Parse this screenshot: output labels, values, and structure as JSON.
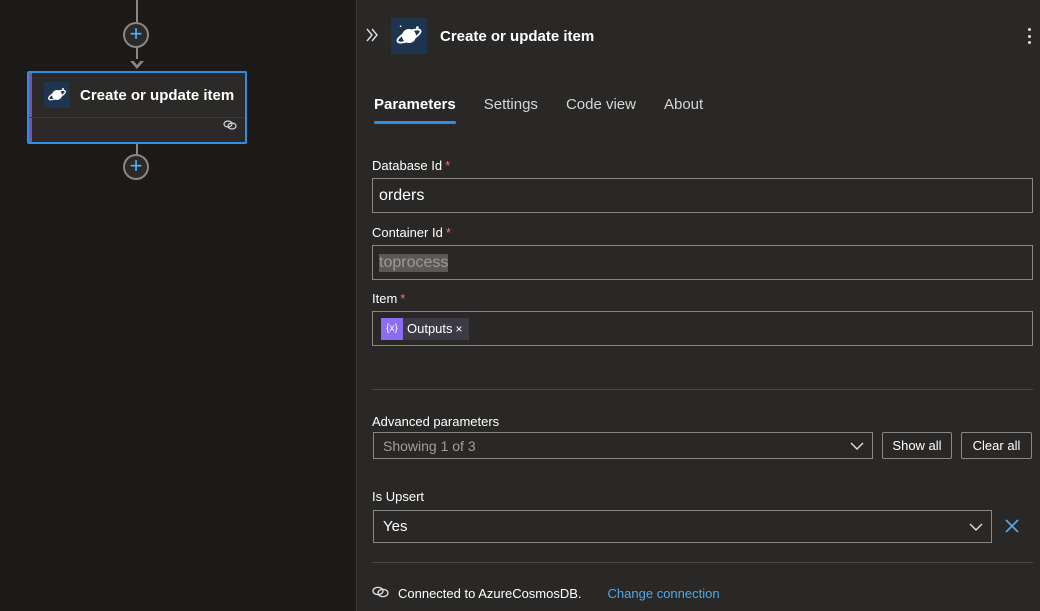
{
  "canvas": {
    "node": {
      "title": "Create or update item",
      "icon": "cosmos-db-icon"
    },
    "add_symbol": "+"
  },
  "panel": {
    "title": "Create or update item",
    "tabs": [
      {
        "label": "Parameters",
        "active": true
      },
      {
        "label": "Settings",
        "active": false
      },
      {
        "label": "Code view",
        "active": false
      },
      {
        "label": "About",
        "active": false
      }
    ],
    "fields": {
      "database_id": {
        "label": "Database Id",
        "required": "*",
        "value": "orders"
      },
      "container_id": {
        "label": "Container Id",
        "required": "*",
        "value": "toprocess"
      },
      "item": {
        "label": "Item",
        "required": "*",
        "token": {
          "icon_text": "{x}",
          "label": "Outputs",
          "remove": "×"
        }
      }
    },
    "advanced": {
      "label": "Advanced parameters",
      "value": "Showing 1 of 3",
      "show_all": "Show all",
      "clear_all": "Clear all"
    },
    "is_upsert": {
      "label": "Is Upsert",
      "value": "Yes"
    },
    "footer": {
      "connection_text": "Connected to AzureCosmosDB.",
      "change_link": "Change connection"
    }
  },
  "colors": {
    "accent_blue": "#2f8ee0",
    "link_blue": "#4fa8e8",
    "required_red": "#f1707b",
    "token_purple": "#8c6cf2",
    "node_accent_purple": "#7c4fb0"
  }
}
